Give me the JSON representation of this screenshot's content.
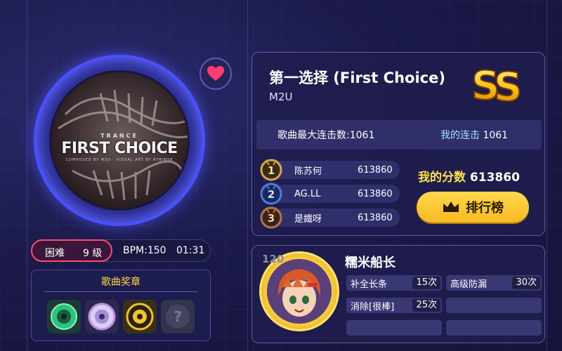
{
  "song": {
    "title": "第一选择 (First Choice)",
    "artist": "M2U",
    "cover": {
      "genre": "TRANCE",
      "title": "FIRST CHOICE",
      "credits": "COMPOSED BY M2U · VISUAL ART BY RYBINSK"
    },
    "favorite_icon": "heart-icon",
    "rank_grade": "SS"
  },
  "combo": {
    "max_label": "歌曲最大连击数:1061",
    "mine_label": "我的连击",
    "mine_value": "1061"
  },
  "leaderboard": [
    {
      "rank": "1",
      "name": "陈苏何",
      "score": "613860",
      "medal_color": "#d9a64a"
    },
    {
      "rank": "2",
      "name": "AG.LL",
      "score": "613860",
      "medal_color": "#4a7bd9"
    },
    {
      "rank": "3",
      "name": "是鐵呀",
      "score": "613860",
      "medal_color": "#b0764a"
    }
  ],
  "my_score": {
    "label": "我的分数",
    "value": "613860"
  },
  "rank_button": {
    "label": "排行榜",
    "icon": "crown-icon"
  },
  "difficulty": {
    "name": "困难",
    "level": "9 级",
    "bpm": "BPM:150",
    "duration": "01:31"
  },
  "medals": {
    "title": "歌曲奖章",
    "items": [
      {
        "icon": "green-disc-medal-icon",
        "color": "#2ec27e"
      },
      {
        "icon": "purple-disc-medal-icon",
        "color": "#b890e8"
      },
      {
        "icon": "gold-disc-medal-icon",
        "color": "#f2c230"
      },
      {
        "icon": "locked-medal-icon",
        "color": "#444460"
      }
    ]
  },
  "player": {
    "level": "120",
    "name": "糯米船长",
    "stats": [
      {
        "label": "补全长条",
        "value": "15次"
      },
      {
        "label": "高级防漏",
        "value": "30次"
      },
      {
        "label": "消除[很棒]",
        "value": "25次"
      }
    ]
  }
}
